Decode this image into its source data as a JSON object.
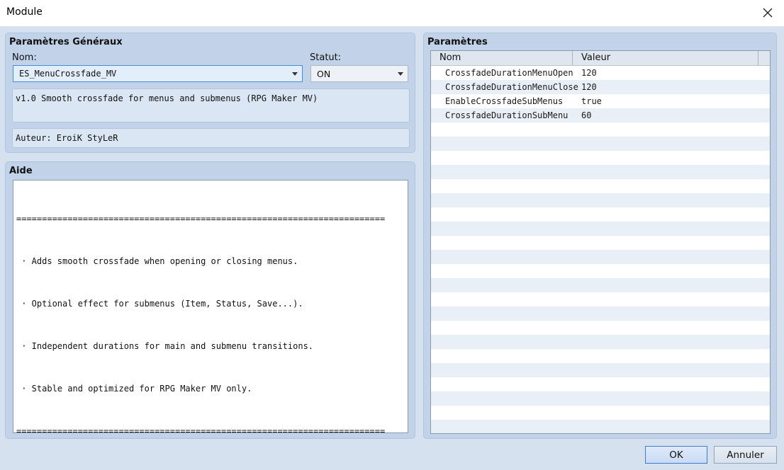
{
  "window": {
    "title": "Module"
  },
  "general": {
    "group_title": "Paramètres Généraux",
    "name_label": "Nom:",
    "name_value": "ES_MenuCrossfade_MV",
    "status_label": "Statut:",
    "status_value": "ON",
    "description": "v1.0 Smooth crossfade for menus and submenus (RPG Maker MV)",
    "author": "Auteur: EroiK StyLeR"
  },
  "help": {
    "group_title": "Aide",
    "lines": [
      "========================================================================",
      " · Adds smooth crossfade when opening or closing menus.",
      " · Optional effect for submenus (Item, Status, Save...).",
      " · Independent durations for main and submenu transitions.",
      " · Stable and optimized for RPG Maker MV only.",
      "========================================================================"
    ]
  },
  "params": {
    "group_title": "Paramètres",
    "columns": [
      "Nom",
      "Valeur"
    ],
    "rows": [
      {
        "name": "CrossfadeDurationMenuOpen",
        "value": "120"
      },
      {
        "name": "CrossfadeDurationMenuClose",
        "value": "120"
      },
      {
        "name": "EnableCrossfadeSubMenus",
        "value": "true"
      },
      {
        "name": "CrossfadeDurationSubMenu",
        "value": "60"
      }
    ]
  },
  "buttons": {
    "ok": "OK",
    "cancel": "Annuler"
  },
  "colors": {
    "window_bg": "#d6e1ef",
    "panel_bg": "#c2d3e9",
    "row_alt": "#e9eff6",
    "accent": "#3d7bd4"
  }
}
